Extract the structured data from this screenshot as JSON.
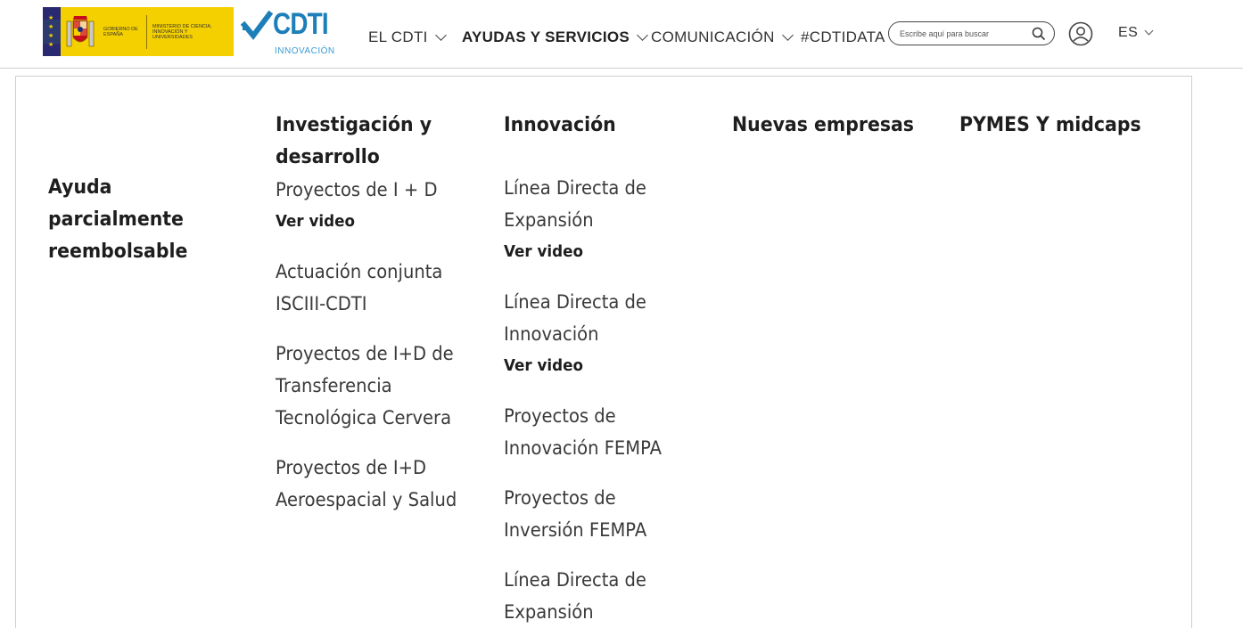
{
  "header": {
    "gov_logo": {
      "text_gobierno": "GOBIERNO DE ESPAÑA",
      "text_ministerio": "MINISTERIO DE CIENCIA, INNOVACIÓN Y UNIVERSIDADES",
      "colors": {
        "background": "#f5d000",
        "flag_blue": "#1b2c7a",
        "flag_red": "#c60b1e"
      }
    },
    "cdti_logo": {
      "word": "CDTI",
      "sub": "INNOVACIÓN",
      "color": "#1d7fb8"
    },
    "nav": [
      {
        "label": "EL CDTI",
        "has_dropdown": true,
        "active": false
      },
      {
        "label": "AYUDAS Y SERVICIOS",
        "has_dropdown": true,
        "active": true
      },
      {
        "label": "COMUNICACIÓN",
        "has_dropdown": true,
        "active": false
      },
      {
        "label": "#CDTIDATA",
        "has_dropdown": false,
        "active": false
      }
    ],
    "search": {
      "placeholder": "Escribe aquí para buscar",
      "icon": "search-icon"
    },
    "user_icon": "user-icon",
    "language": {
      "label": "ES",
      "icon": "chevron-down-icon"
    }
  },
  "menu": {
    "row_label": "Ayuda parcialmente reembolsable",
    "columns": [
      {
        "heading": "Investigación y desarrollo",
        "items": [
          {
            "label": "Proyectos de I + D",
            "video": "Ver video"
          },
          {
            "label": "Actuación conjunta ISCIII-CDTI"
          },
          {
            "label": "Proyectos de I+D de Transferencia Tecnológica Cervera"
          },
          {
            "label": "Proyectos de I+D Aeroespacial y Salud"
          }
        ]
      },
      {
        "heading": "Innovación",
        "items": [
          {
            "label": "Línea Directa de Expansión",
            "video": "Ver video"
          },
          {
            "label": "Línea Directa de Innovación",
            "video": "Ver video"
          },
          {
            "label": "Proyectos de Innovación FEMPA"
          },
          {
            "label": "Proyectos de Inversión FEMPA"
          },
          {
            "label": "Línea Directa de Expansión"
          }
        ]
      },
      {
        "heading": "Nuevas empresas",
        "items": []
      },
      {
        "heading": "PYMES Y midcaps",
        "items": []
      }
    ]
  }
}
